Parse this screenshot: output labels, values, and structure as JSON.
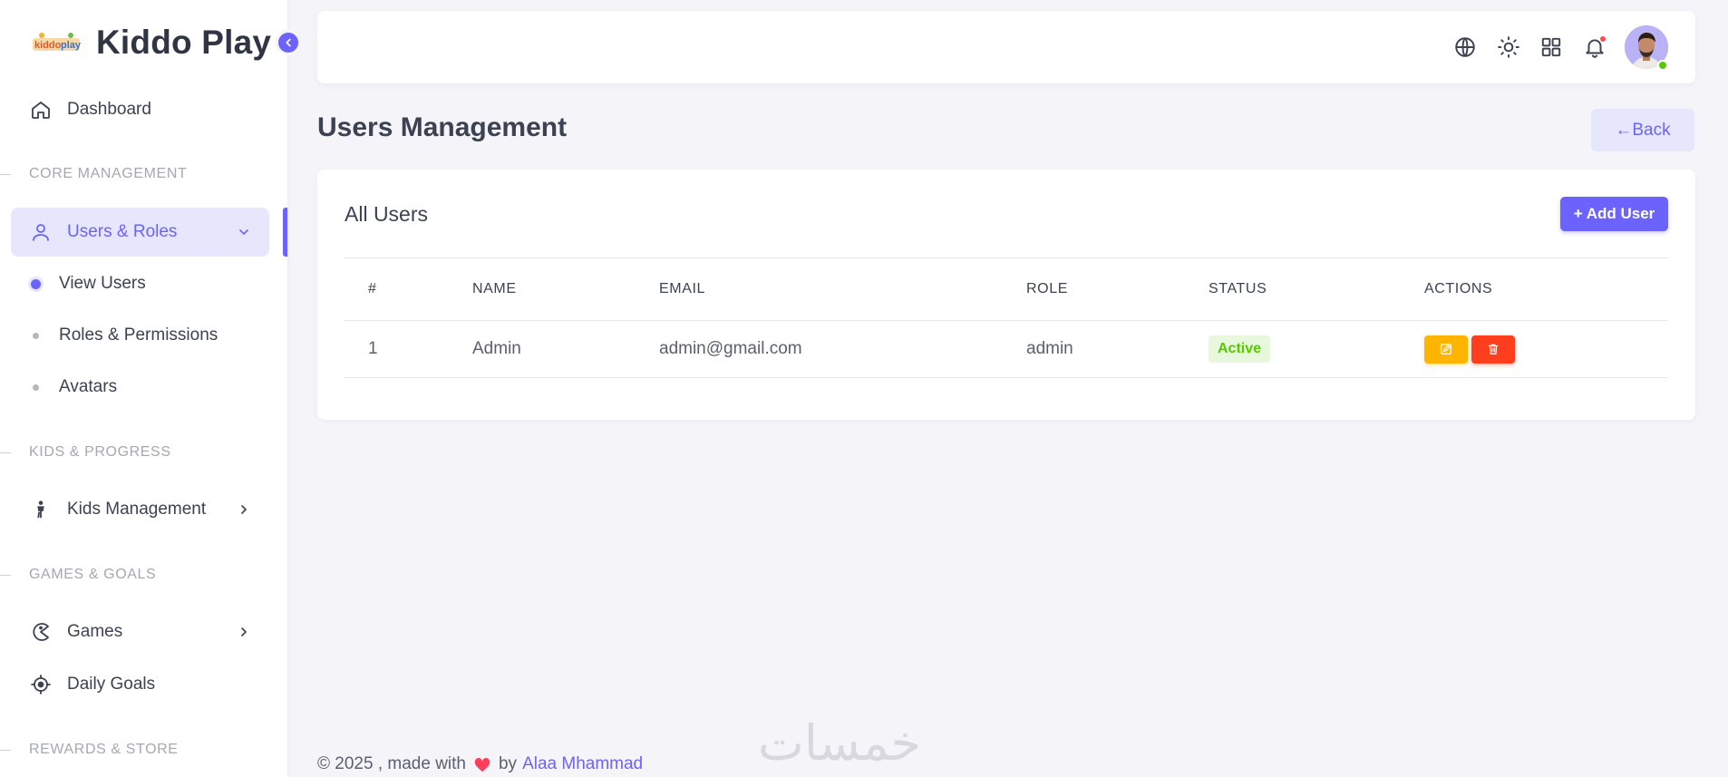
{
  "app": {
    "title": "Kiddo Play",
    "logo_text": "kiddoplay"
  },
  "sidebar": {
    "dashboard": "Dashboard",
    "sections": {
      "core": "CORE MANAGEMENT",
      "kids": "KIDS & PROGRESS",
      "games": "GAMES & GOALS",
      "rewards": "REWARDS & STORE"
    },
    "users_roles": "Users & Roles",
    "sub_items": [
      "View Users",
      "Roles & Permissions",
      "Avatars"
    ],
    "kids_management": "Kids Management",
    "games": "Games",
    "daily_goals": "Daily Goals"
  },
  "topbar": {
    "icons": [
      "globe-icon",
      "sun-icon",
      "grid-icon",
      "bell-icon"
    ],
    "avatar": "user-avatar"
  },
  "page": {
    "title": "Users Management",
    "back_label": "←Back"
  },
  "card": {
    "title": "All Users",
    "add_label": "+ Add User",
    "columns": [
      "#",
      "NAME",
      "EMAIL",
      "ROLE",
      "STATUS",
      "ACTIONS"
    ],
    "rows": [
      {
        "index": "1",
        "name": "Admin",
        "email": "admin@gmail.com",
        "role": "admin",
        "status": "Active"
      }
    ]
  },
  "footer": {
    "prefix": "© 2025 , made with",
    "by": "by",
    "author": "Alaa Mhammad"
  },
  "watermark": "خمسات",
  "colors": {
    "primary": "#6c63ff",
    "success": "#56ca00",
    "warning": "#ffb400",
    "danger": "#ff3e1d"
  }
}
